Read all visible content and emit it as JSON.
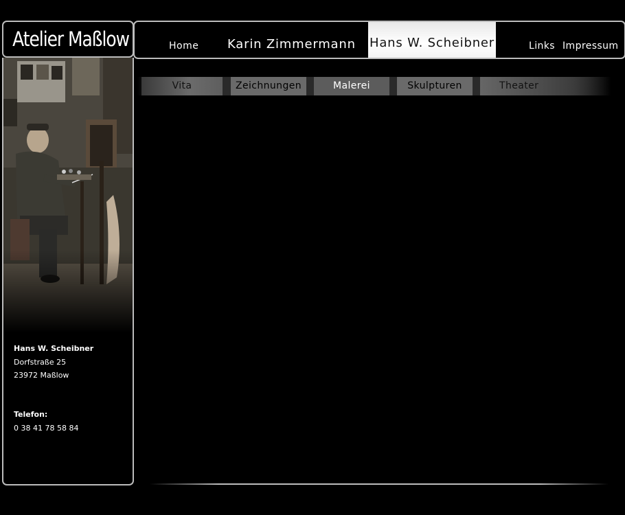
{
  "logo": {
    "text": "Atelier Maßlow"
  },
  "topnav": {
    "home": "Home",
    "karin": "Karin Zimmermann",
    "hans": "Hans W. Scheibner",
    "links": "Links",
    "impressum": "Impressum",
    "active": "Hans W. Scheibner"
  },
  "subnav": {
    "items": [
      "Vita",
      "Zeichnungen",
      "Malerei",
      "Skulpturen",
      "Theater"
    ],
    "active": "Malerei"
  },
  "contact": {
    "name": "Hans W. Scheibner",
    "street": "Dorfstraße 25",
    "city": "23972 Maßlow",
    "phone_label": "Telefon:",
    "phone": "0 38 41 78 58 84"
  },
  "colors": {
    "background": "#000000",
    "frame": "#bdbdbd",
    "active_tab": "#ffffff",
    "subnav_button": "#6a6a6a"
  }
}
